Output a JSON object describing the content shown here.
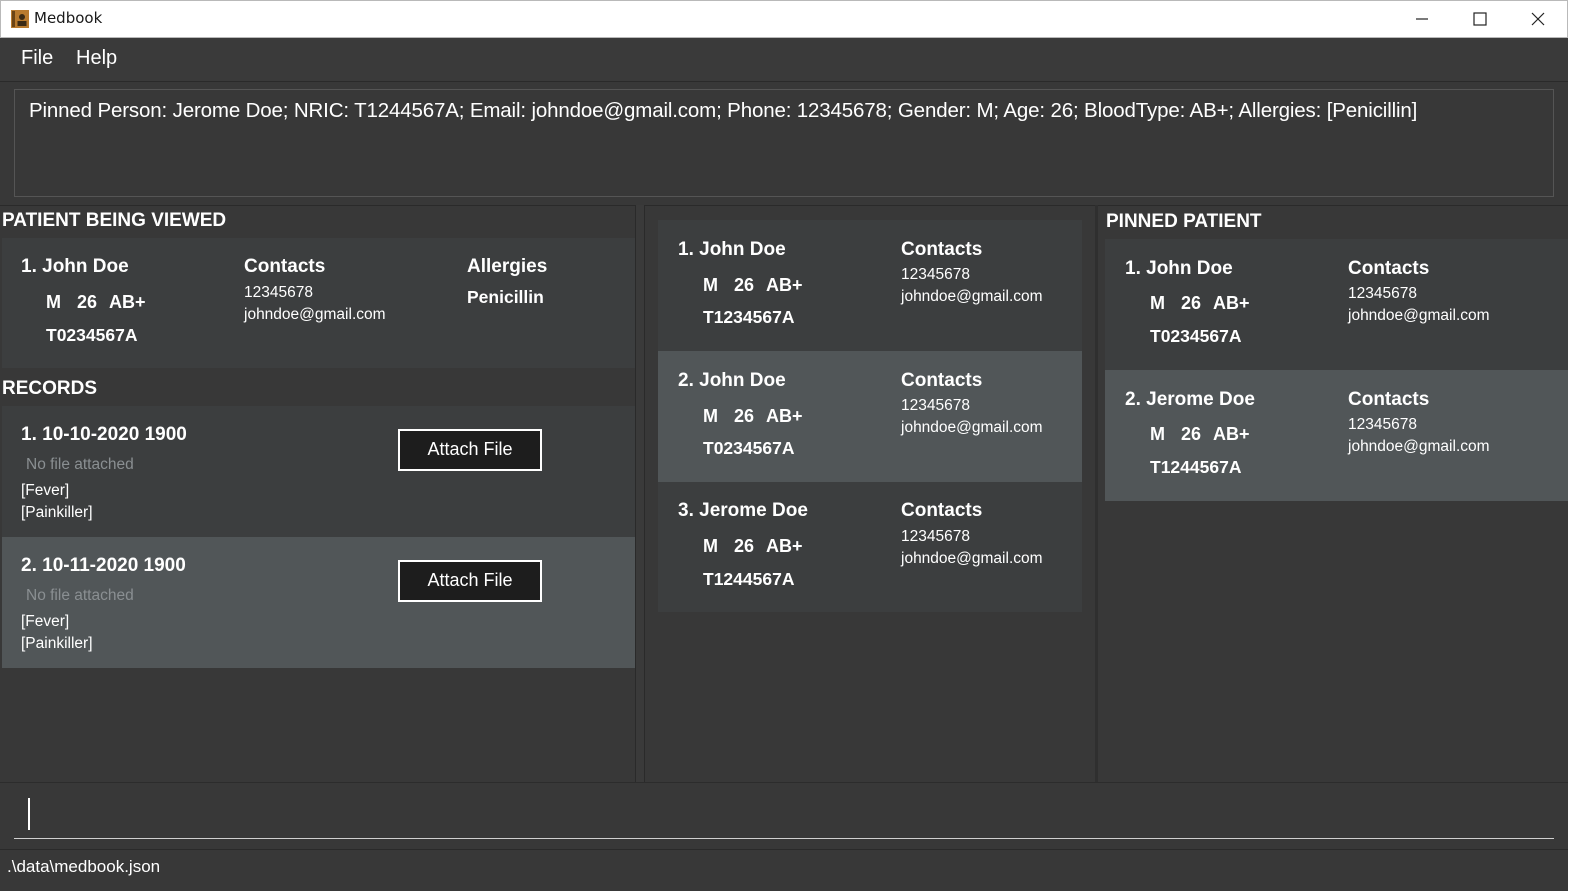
{
  "window": {
    "title": "Medbook"
  },
  "menu": {
    "items": [
      "File",
      "Help"
    ]
  },
  "pinned_display": "Pinned Person: Jerome Doe; NRIC: T1244567A; Email: johndoe@gmail.com; Phone: 12345678; Gender: M; Age: 26; BloodType: AB+; Allergies: [Penicillin]",
  "viewed": {
    "header": "PATIENT BEING VIEWED",
    "name": "1. John Doe",
    "gender": "M",
    "age": "26",
    "blood": "AB+",
    "nric": "T0234567A",
    "contacts_label": "Contacts",
    "phone": "12345678",
    "email": "johndoe@gmail.com",
    "allergies_label": "Allergies",
    "allergy": "Penicillin"
  },
  "records": {
    "header": "RECORDS",
    "items": [
      {
        "title": "1. 10-10-2020 1900",
        "file": "No file attached",
        "tags": [
          "[Fever]",
          "[Painkiller]"
        ],
        "button": "Attach File"
      },
      {
        "title": "2. 10-11-2020 1900",
        "file": "No file attached",
        "tags": [
          "[Fever]",
          "[Painkiller]"
        ],
        "button": "Attach File"
      }
    ]
  },
  "patients": {
    "contacts_label": "Contacts",
    "items": [
      {
        "name": "1. John Doe",
        "gender": "M",
        "age": "26",
        "blood": "AB+",
        "nric": "T1234567A",
        "phone": "12345678",
        "email": "johndoe@gmail.com"
      },
      {
        "name": "2. John Doe",
        "gender": "M",
        "age": "26",
        "blood": "AB+",
        "nric": "T0234567A",
        "phone": "12345678",
        "email": "johndoe@gmail.com"
      },
      {
        "name": "3. Jerome Doe",
        "gender": "M",
        "age": "26",
        "blood": "AB+",
        "nric": "T1244567A",
        "phone": "12345678",
        "email": "johndoe@gmail.com"
      }
    ]
  },
  "pinned": {
    "header": "PINNED PATIENT",
    "contacts_label": "Contacts",
    "items": [
      {
        "name": "1. John Doe",
        "gender": "M",
        "age": "26",
        "blood": "AB+",
        "nric": "T0234567A",
        "phone": "12345678",
        "email": "johndoe@gmail.com"
      },
      {
        "name": "2. Jerome Doe",
        "gender": "M",
        "age": "26",
        "blood": "AB+",
        "nric": "T1244567A",
        "phone": "12345678",
        "email": "johndoe@gmail.com"
      }
    ]
  },
  "command": {
    "value": ""
  },
  "status": {
    "path": ".\\data\\medbook.json"
  }
}
